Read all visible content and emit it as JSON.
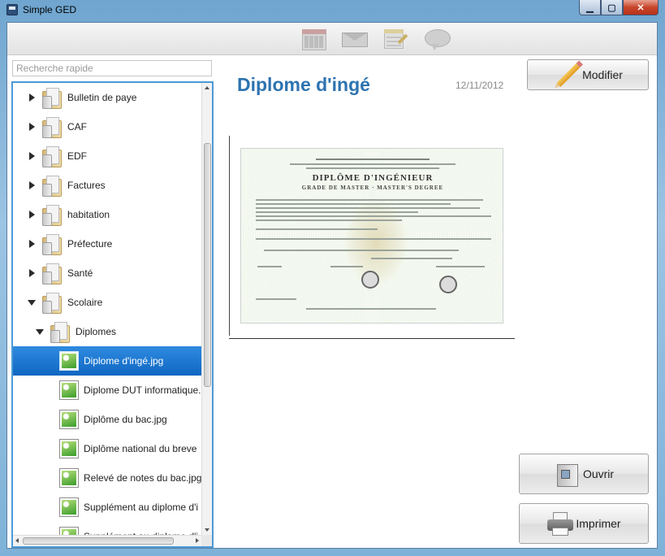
{
  "window": {
    "title": "Simple GED",
    "minimize": "▁",
    "maximize": "▢",
    "close": "✕"
  },
  "toolbar": {
    "icons": [
      "calendar-icon",
      "mail-icon",
      "note-icon",
      "comment-icon"
    ]
  },
  "search": {
    "placeholder": "Recherche rapide",
    "value": ""
  },
  "tree": {
    "items": [
      {
        "label": "Bulletin de paye",
        "type": "folder",
        "expanded": false
      },
      {
        "label": "CAF",
        "type": "folder",
        "expanded": false
      },
      {
        "label": "EDF",
        "type": "folder",
        "expanded": false
      },
      {
        "label": "Factures",
        "type": "folder",
        "expanded": false
      },
      {
        "label": "habitation",
        "type": "folder",
        "expanded": false
      },
      {
        "label": "Préfecture",
        "type": "folder",
        "expanded": false
      },
      {
        "label": "Santé",
        "type": "folder",
        "expanded": false
      },
      {
        "label": "Scolaire",
        "type": "folder",
        "expanded": true
      },
      {
        "label": "Diplomes",
        "type": "folder",
        "expanded": true
      },
      {
        "label": "Diplome d'ingé.jpg",
        "type": "image",
        "selected": true
      },
      {
        "label": "Diplome DUT informatique.",
        "type": "image"
      },
      {
        "label": "Diplôme du bac.jpg",
        "type": "image"
      },
      {
        "label": "Diplôme national du breve",
        "type": "image"
      },
      {
        "label": "Relevé de notes du bac.jpg",
        "type": "image"
      },
      {
        "label": "Supplément au diplome d'i",
        "type": "image"
      },
      {
        "label": "Supplément au diplome d'i",
        "type": "image"
      }
    ]
  },
  "document": {
    "title": "Diplome d'ingé",
    "date": "12/11/2012",
    "certificate": {
      "heading": "DIPLÔME D'INGÉNIEUR",
      "subheading": "GRADE DE MASTER · MASTER'S DEGREE"
    }
  },
  "buttons": {
    "modifier": "Modifier",
    "ouvrir": "Ouvrir",
    "imprimer": "Imprimer"
  },
  "colors": {
    "title_blue": "#2d73b0",
    "selection": "#1a73d0",
    "tree_border": "#4c9ad6"
  }
}
